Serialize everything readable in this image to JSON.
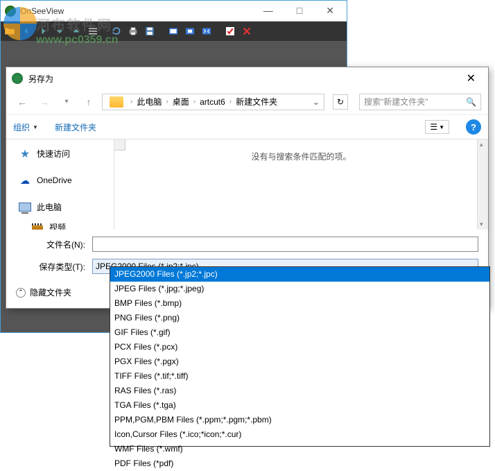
{
  "main_window": {
    "title": "OnSeeView",
    "controls": {
      "min": "—",
      "max": "□",
      "close": "✕"
    }
  },
  "watermark": {
    "cn_text": "河布软件网",
    "url": "www.pc0359.cn"
  },
  "dialog": {
    "title": "另存为",
    "close": "✕",
    "breadcrumb": {
      "items": [
        "此电脑",
        "桌面",
        "artcut6",
        "新建文件夹"
      ],
      "sep": "›"
    },
    "search_placeholder": "搜索\"新建文件夹\"",
    "toolbar": {
      "organize": "组织",
      "new_folder": "新建文件夹"
    },
    "sidebar": {
      "quick_access": "快速访问",
      "onedrive": "OneDrive",
      "this_pc": "此电脑",
      "video": "视频"
    },
    "empty_message": "没有与搜索条件匹配的项。",
    "filename_label": "文件名(N):",
    "filetype_label": "保存类型(T):",
    "filetype_value": "JPEG2000 Files (*.jp2;*.jpc)",
    "hide_folders": "隐藏文件夹",
    "type_options": [
      "JPEG2000 Files (*.jp2;*.jpc)",
      "JPEG Files (*.jpg;*.jpeg)",
      "BMP Files (*.bmp)",
      "PNG Files (*.png)",
      "GIF Files (*.gif)",
      "PCX Files (*.pcx)",
      "PGX Files (*.pgx)",
      "TIFF Files (*.tif;*.tiff)",
      "RAS Files (*.ras)",
      "TGA Files (*.tga)",
      "PPM,PGM,PBM Files (*.ppm;*.pgm;*.pbm)",
      "Icon,Cursor Files (*.ico;*icon;*.cur)",
      "WMF Files (*.wmf)",
      "PDF Files (*pdf)"
    ]
  }
}
